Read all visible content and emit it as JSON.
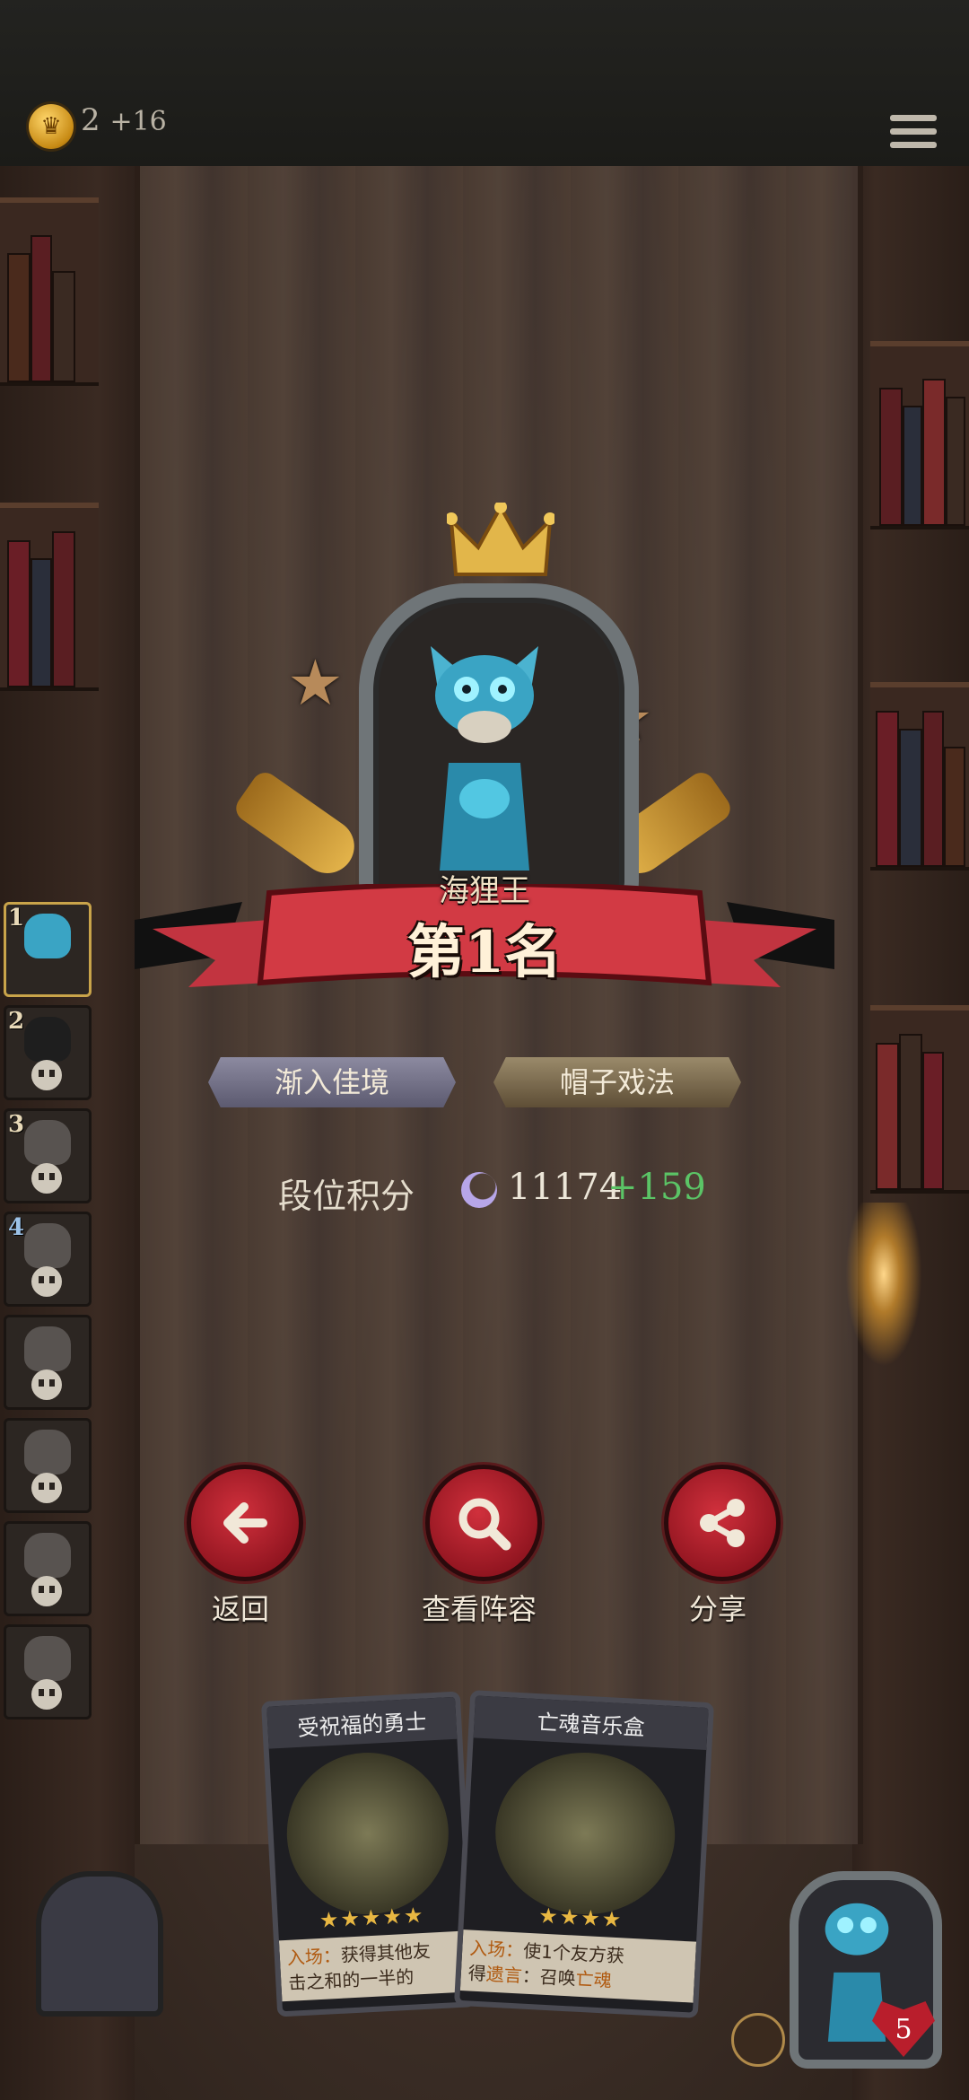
{
  "topbar": {
    "coin_count": "2",
    "coin_delta": "+16",
    "coin_icon": "crown-coin-icon",
    "menu_icon": "hamburger-menu-icon"
  },
  "result": {
    "hero_name": "海狸王",
    "rank_text": "第1名"
  },
  "tags": [
    "渐入佳境",
    "帽子戏法"
  ],
  "score": {
    "label": "段位积分",
    "icon": "moon-rank-icon",
    "value": "11174",
    "delta": "+159"
  },
  "actions": [
    {
      "label": "返回",
      "icon": "arrow-left-icon"
    },
    {
      "label": "查看阵容",
      "icon": "magnifier-icon"
    },
    {
      "label": "分享",
      "icon": "share-icon"
    }
  ],
  "roster": [
    "1",
    "2",
    "3",
    "4",
    "",
    "",
    "",
    ""
  ],
  "cards": [
    {
      "title": "受祝福的勇士",
      "stars": "★★★★★",
      "text_prefix": "入场：",
      "text": "获得其他友",
      "text2": "击之和的一半的"
    },
    {
      "title": "亡魂音乐盒",
      "stars": "★★★★",
      "text_prefix": "入场：",
      "text": "使1个友方获",
      "text2_a": "得",
      "text2_hl": "遗言",
      "text2_b": "：召唤",
      "text2_hl2": "亡魂"
    }
  ],
  "player": {
    "lives": "5"
  },
  "colors": {
    "banner_red": "#d23a44",
    "score_delta_green": "#5bc466",
    "button_red": "#c8202c"
  }
}
